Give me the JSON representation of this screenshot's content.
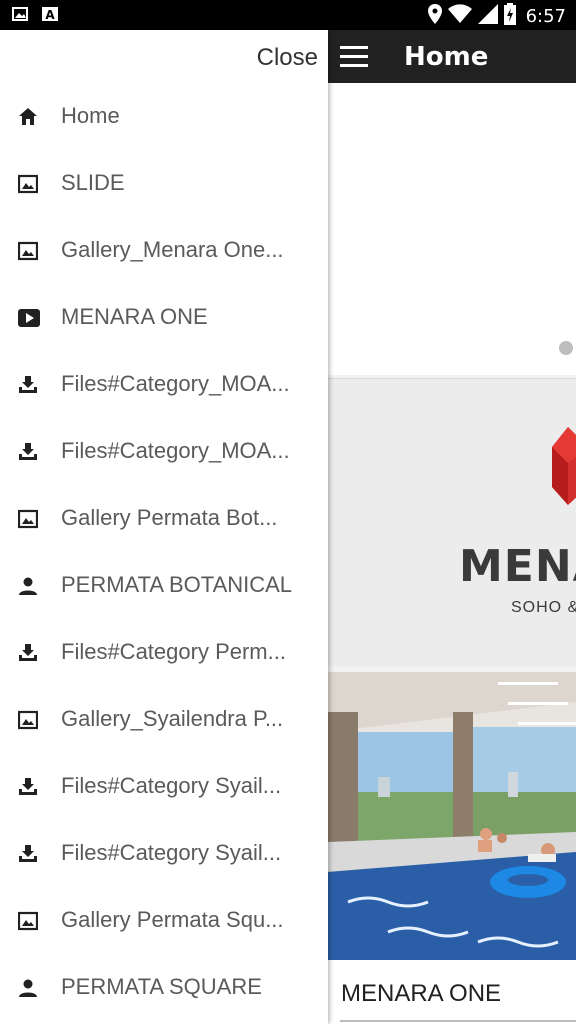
{
  "status_bar": {
    "time": "6:57",
    "left_icons": [
      "image-icon",
      "a-text-icon"
    ],
    "right_icons": [
      "location-icon",
      "wifi-icon",
      "signal-icon",
      "battery-charging-icon"
    ]
  },
  "app": {
    "title": "Home",
    "logo_text": "MENA",
    "logo_subtext": "SOHO &",
    "caption": "MENARA ONE"
  },
  "drawer": {
    "close_label": "Close",
    "items": [
      {
        "icon": "home-icon",
        "label": "Home"
      },
      {
        "icon": "image-icon",
        "label": "SLIDE"
      },
      {
        "icon": "image-icon",
        "label": "Gallery_Menara One..."
      },
      {
        "icon": "youtube-icon",
        "label": "MENARA ONE"
      },
      {
        "icon": "download-icon",
        "label": "Files#Category_MOA..."
      },
      {
        "icon": "download-icon",
        "label": "Files#Category_MOA..."
      },
      {
        "icon": "image-icon",
        "label": "Gallery Permata Bot..."
      },
      {
        "icon": "person-icon",
        "label": "PERMATA BOTANICAL"
      },
      {
        "icon": "download-icon",
        "label": "Files#Category Perm..."
      },
      {
        "icon": "image-icon",
        "label": "Gallery_Syailendra P..."
      },
      {
        "icon": "download-icon",
        "label": "Files#Category Syail..."
      },
      {
        "icon": "download-icon",
        "label": "Files#Category Syail..."
      },
      {
        "icon": "image-icon",
        "label": "Gallery Permata Squ..."
      },
      {
        "icon": "person-icon",
        "label": "PERMATA SQUARE"
      }
    ]
  },
  "colors": {
    "app_bar": "#212121",
    "logo_red": "#d32f2f",
    "text_gray": "#5a5a5a"
  }
}
